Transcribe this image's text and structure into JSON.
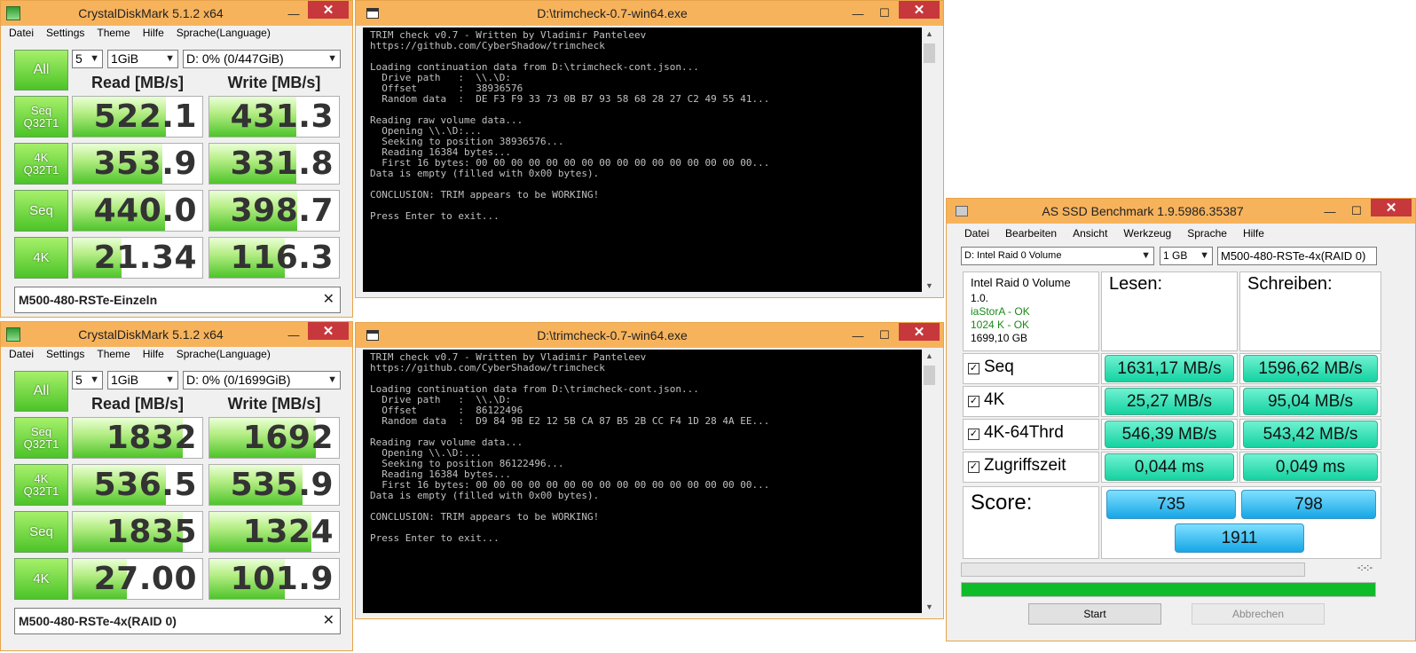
{
  "cdm1": {
    "title": "CrystalDiskMark 5.1.2 x64",
    "menu": [
      "Datei",
      "Settings",
      "Theme",
      "Hilfe",
      "Sprache(Language)"
    ],
    "all_label": "All",
    "count": "5",
    "size": "1GiB",
    "drive": "D: 0% (0/447GiB)",
    "read_header": "Read [MB/s]",
    "write_header": "Write [MB/s]",
    "rows": [
      {
        "label1": "Seq",
        "label2": "Q32T1",
        "read": "522.1",
        "write": "431.3",
        "read_frac": 0.72,
        "write_frac": 0.67
      },
      {
        "label1": "4K",
        "label2": "Q32T1",
        "read": "353.9",
        "write": "331.8",
        "read_frac": 0.69,
        "write_frac": 0.67
      },
      {
        "label1": "Seq",
        "label2": "",
        "read": "440.0",
        "write": "398.7",
        "read_frac": 0.71,
        "write_frac": 0.68
      },
      {
        "label1": "4K",
        "label2": "",
        "read": "21.34",
        "write": "116.3",
        "read_frac": 0.38,
        "write_frac": 0.58
      }
    ],
    "comment": "M500-480-RSTe-Einzeln"
  },
  "cdm2": {
    "title": "CrystalDiskMark 5.1.2 x64",
    "menu": [
      "Datei",
      "Settings",
      "Theme",
      "Hilfe",
      "Sprache(Language)"
    ],
    "all_label": "All",
    "count": "5",
    "size": "1GiB",
    "drive": "D: 0% (0/1699GiB)",
    "read_header": "Read [MB/s]",
    "write_header": "Write [MB/s]",
    "rows": [
      {
        "label1": "Seq",
        "label2": "Q32T1",
        "read": "1832",
        "write": "1692",
        "read_frac": 0.85,
        "write_frac": 0.82
      },
      {
        "label1": "4K",
        "label2": "Q32T1",
        "read": "536.5",
        "write": "535.9",
        "read_frac": 0.72,
        "write_frac": 0.72
      },
      {
        "label1": "Seq",
        "label2": "",
        "read": "1835",
        "write": "1324",
        "read_frac": 0.85,
        "write_frac": 0.79
      },
      {
        "label1": "4K",
        "label2": "",
        "read": "27.00",
        "write": "101.9",
        "read_frac": 0.42,
        "write_frac": 0.58
      }
    ],
    "comment": "M500-480-RSTe-4x(RAID 0)"
  },
  "trim1": {
    "title": "D:\\trimcheck-0.7-win64.exe",
    "output": "TRIM check v0.7 - Written by Vladimir Panteleev\nhttps://github.com/CyberShadow/trimcheck\n\nLoading continuation data from D:\\trimcheck-cont.json...\n  Drive path   :  \\\\.\\D:\n  Offset       :  38936576\n  Random data  :  DE F3 F9 33 73 0B B7 93 58 68 28 27 C2 49 55 41...\n\nReading raw volume data...\n  Opening \\\\.\\D:...\n  Seeking to position 38936576...\n  Reading 16384 bytes...\n  First 16 bytes: 00 00 00 00 00 00 00 00 00 00 00 00 00 00 00 00...\nData is empty (filled with 0x00 bytes).\n\nCONCLUSION: TRIM appears to be WORKING!\n\nPress Enter to exit..."
  },
  "trim2": {
    "title": "D:\\trimcheck-0.7-win64.exe",
    "output": "TRIM check v0.7 - Written by Vladimir Panteleev\nhttps://github.com/CyberShadow/trimcheck\n\nLoading continuation data from D:\\trimcheck-cont.json...\n  Drive path   :  \\\\.\\D:\n  Offset       :  86122496\n  Random data  :  D9 84 9B E2 12 5B CA 87 B5 2B CC F4 1D 28 4A EE...\n\nReading raw volume data...\n  Opening \\\\.\\D:...\n  Seeking to position 86122496...\n  Reading 16384 bytes...\n  First 16 bytes: 00 00 00 00 00 00 00 00 00 00 00 00 00 00 00 00...\nData is empty (filled with 0x00 bytes).\n\nCONCLUSION: TRIM appears to be WORKING!\n\nPress Enter to exit..."
  },
  "asssd": {
    "title": "AS SSD Benchmark 1.9.5986.35387",
    "menu": [
      "Datei",
      "Bearbeiten",
      "Ansicht",
      "Werkzeug",
      "Sprache",
      "Hilfe"
    ],
    "drive": "D: Intel Raid 0 Volume",
    "size": "1 GB",
    "comment": "M500-480-RSTe-4x(RAID 0)",
    "info": {
      "name": "Intel Raid 0 Volume",
      "version": "1.0.",
      "driver": "iaStorA - OK",
      "align": "1024 K - OK",
      "capacity": "1699,10 GB"
    },
    "read_header": "Lesen:",
    "write_header": "Schreiben:",
    "tests": [
      {
        "label": "Seq",
        "read": "1631,17 MB/s",
        "write": "1596,62 MB/s"
      },
      {
        "label": "4K",
        "read": "25,27 MB/s",
        "write": "95,04 MB/s"
      },
      {
        "label": "4K-64Thrd",
        "read": "546,39 MB/s",
        "write": "543,42 MB/s"
      },
      {
        "label": "Zugriffszeit",
        "read": "0,044 ms",
        "write": "0,049 ms"
      }
    ],
    "score_label": "Score:",
    "score_read": "735",
    "score_write": "798",
    "score_total": "1911",
    "time": "-:-:-",
    "progress": 1.0,
    "start_label": "Start",
    "cancel_label": "Abbrechen"
  },
  "colors": {
    "titlebar": "#f7b35c",
    "close": "#c7383c",
    "cdm_green": "#4cc428",
    "teal": "#14d2a0",
    "blue": "#16a6e6",
    "progress": "#0ebc2a"
  }
}
